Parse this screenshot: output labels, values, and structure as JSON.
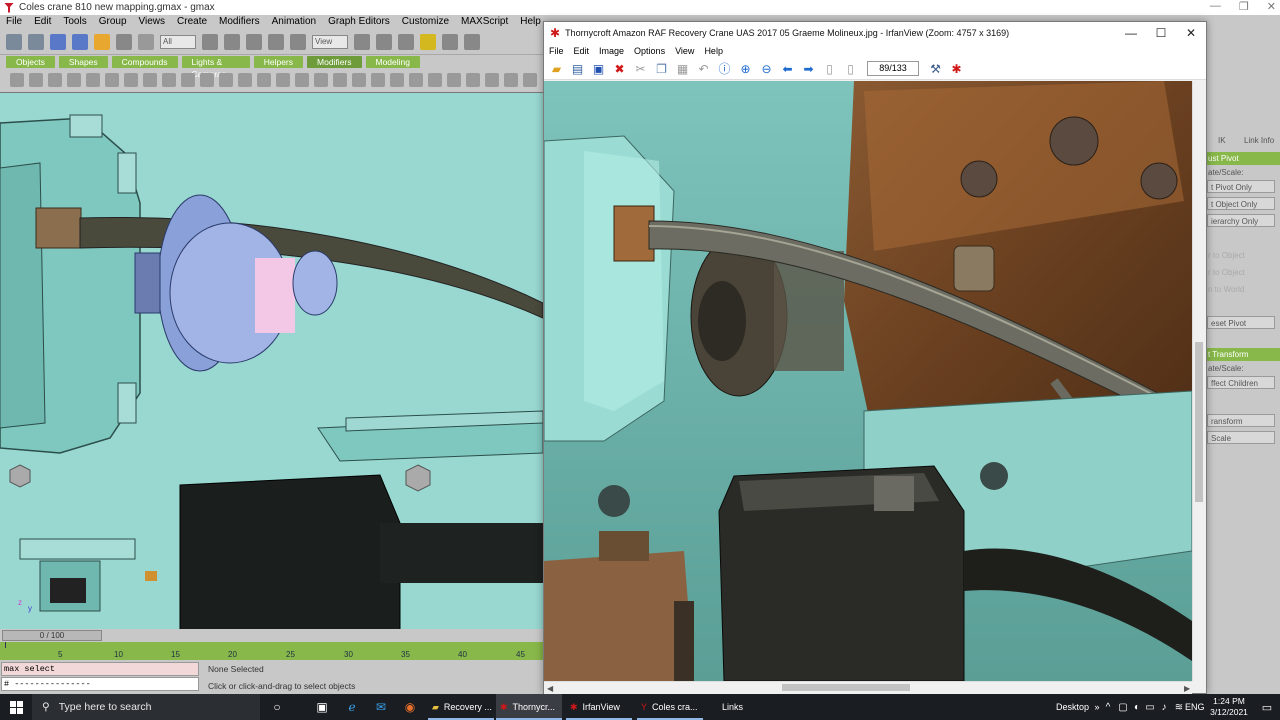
{
  "gmax": {
    "title": "Coles crane 810 new mapping.gmax - gmax",
    "menu": [
      "File",
      "Edit",
      "Tools",
      "Group",
      "Views",
      "Create",
      "Modifiers",
      "Animation",
      "Graph Editors",
      "Customize",
      "MAXScript",
      "Help"
    ],
    "selection_filter": "All",
    "ref_coord": "View",
    "tabs": [
      "Objects",
      "Shapes",
      "Compounds",
      "Lights & Cameras",
      "Helpers",
      "Modifiers",
      "Modeling"
    ],
    "active_tab": "Modifiers",
    "time_slider": "0 / 100",
    "ruler_ticks": [
      "5",
      "10",
      "15",
      "20",
      "25",
      "30",
      "35",
      "40",
      "45"
    ],
    "listener_input": "max select",
    "listener_output": "# ---------------",
    "status_selection": "None Selected",
    "status_prompt": "Click or click-and-drag to select objects",
    "command_panel": {
      "tabs": [
        "IK",
        "Link Info"
      ],
      "adjust_pivot_header": "ust Pivot",
      "buttons": [
        "ate/Scale:",
        "t Pivot Only",
        "t Object Only",
        "ierarchy Only"
      ],
      "ghost_buttons": [
        "r to Object",
        "r to Object",
        "n to World"
      ],
      "reset_pivot": "eset Pivot",
      "adjust_transform_header": "t Transform",
      "buttons2": [
        "ate/Scale:",
        "ffect Children"
      ],
      "buttons3": [
        "ransform",
        "Scale"
      ]
    }
  },
  "irfanview": {
    "title": "Thornycroft Amazon RAF Recovery Crane UAS 2017 05 Graeme Molineux.jpg - IrfanView (Zoom: 4757 x 3169)",
    "menu": [
      "File",
      "Edit",
      "Image",
      "Options",
      "View",
      "Help"
    ],
    "page_counter": "89/133",
    "image_subject": "engine close-up with cyan paint, rusty pipe and black magneto"
  },
  "taskbar": {
    "search_placeholder": "Type here to search",
    "apps": [
      {
        "label": "Recovery ...",
        "icon": "folder-icon"
      },
      {
        "label": "Thornycr...",
        "icon": "irfanview-icon"
      },
      {
        "label": "IrfanView",
        "icon": "irfanview-icon"
      },
      {
        "label": "Coles cra...",
        "icon": "gmax-icon"
      }
    ],
    "links": "Links",
    "desktop": "Desktop",
    "lang": "ENG",
    "time": "1:24 PM",
    "date": "3/12/2021"
  },
  "colors": {
    "viewport_bg": "#98d8d0",
    "gmax_green": "#88b84a",
    "taskbar": "#1a1d22",
    "irfan_red": "#d01818"
  }
}
